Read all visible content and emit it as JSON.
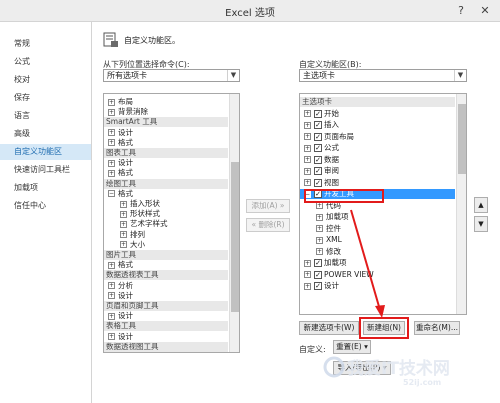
{
  "window": {
    "title": "Excel 选项"
  },
  "sidebar": {
    "items": [
      {
        "label": "常规"
      },
      {
        "label": "公式"
      },
      {
        "label": "校对"
      },
      {
        "label": "保存"
      },
      {
        "label": "语言"
      },
      {
        "label": "高级"
      },
      {
        "label": "自定义功能区"
      },
      {
        "label": "快速访问工具栏"
      },
      {
        "label": "加载项"
      },
      {
        "label": "信任中心"
      }
    ],
    "active_index": 6
  },
  "header": {
    "text": "自定义功能区。"
  },
  "left_panel": {
    "label": "从下列位置选择命令(C):",
    "dropdown_value": "所有选项卡",
    "rows": [
      {
        "text": "布局",
        "kind": "item",
        "indent": 0
      },
      {
        "text": "背景消除",
        "kind": "item",
        "indent": 0
      },
      {
        "text": "SmartArt 工具",
        "kind": "group",
        "indent": 0
      },
      {
        "text": "设计",
        "kind": "item",
        "indent": 0
      },
      {
        "text": "格式",
        "kind": "item",
        "indent": 0
      },
      {
        "text": "图表工具",
        "kind": "group",
        "indent": 0
      },
      {
        "text": "设计",
        "kind": "item",
        "indent": 0
      },
      {
        "text": "格式",
        "kind": "item",
        "indent": 0
      },
      {
        "text": "绘图工具",
        "kind": "group",
        "indent": 0
      },
      {
        "text": "格式",
        "kind": "open",
        "indent": 0
      },
      {
        "text": "插入形状",
        "kind": "item",
        "indent": 1
      },
      {
        "text": "形状样式",
        "kind": "item",
        "indent": 1
      },
      {
        "text": "艺术字样式",
        "kind": "item",
        "indent": 1
      },
      {
        "text": "排列",
        "kind": "item",
        "indent": 1
      },
      {
        "text": "大小",
        "kind": "item",
        "indent": 1
      },
      {
        "text": "图片工具",
        "kind": "group",
        "indent": 0
      },
      {
        "text": "格式",
        "kind": "item",
        "indent": 0
      },
      {
        "text": "数据透视表工具",
        "kind": "group",
        "indent": 0
      },
      {
        "text": "分析",
        "kind": "item",
        "indent": 0
      },
      {
        "text": "设计",
        "kind": "item",
        "indent": 0
      },
      {
        "text": "页眉和页脚工具",
        "kind": "group",
        "indent": 0
      },
      {
        "text": "设计",
        "kind": "item",
        "indent": 0
      },
      {
        "text": "表格工具",
        "kind": "group",
        "indent": 0
      },
      {
        "text": "设计",
        "kind": "item",
        "indent": 0
      },
      {
        "text": "数据透视图工具",
        "kind": "group",
        "indent": 0
      }
    ]
  },
  "middle": {
    "add_label": "添加(A) »",
    "remove_label": "« 删除(R)"
  },
  "right_panel": {
    "label": "自定义功能区(B):",
    "dropdown_value": "主选项卡",
    "rows": [
      {
        "text": "主选项卡",
        "kind": "group",
        "indent": 0
      },
      {
        "text": "开始",
        "kind": "check",
        "indent": 0
      },
      {
        "text": "插入",
        "kind": "check",
        "indent": 0
      },
      {
        "text": "页面布局",
        "kind": "check",
        "indent": 0
      },
      {
        "text": "公式",
        "kind": "check",
        "indent": 0
      },
      {
        "text": "数据",
        "kind": "check",
        "indent": 0
      },
      {
        "text": "审阅",
        "kind": "check",
        "indent": 0
      },
      {
        "text": "视图",
        "kind": "check",
        "indent": 0
      },
      {
        "text": "开发工具",
        "kind": "selected",
        "indent": 0
      },
      {
        "text": "代码",
        "kind": "item",
        "indent": 1
      },
      {
        "text": "加载项",
        "kind": "item",
        "indent": 1
      },
      {
        "text": "控件",
        "kind": "item",
        "indent": 1
      },
      {
        "text": "XML",
        "kind": "item",
        "indent": 1
      },
      {
        "text": "修改",
        "kind": "item",
        "indent": 1
      },
      {
        "text": "加载项",
        "kind": "check",
        "indent": 0
      },
      {
        "text": "POWER VIEW",
        "kind": "check",
        "indent": 0
      },
      {
        "text": "设计",
        "kind": "check",
        "indent": 0
      }
    ],
    "up_symbol": "▲",
    "down_symbol": "▼"
  },
  "buttons": {
    "new_tab": "新建选项卡(W)",
    "new_group": "新建组(N)",
    "rename": "重命名(M)...",
    "custom_label": "自定义:",
    "reset": "重置(E) ▾",
    "import_export": "导入/导出(P) ▾"
  },
  "watermark": {
    "main": "我爱IT技术网",
    "sub": "52ij.com"
  },
  "colors": {
    "selection": "#3399ff",
    "annotation": "#e21b1b",
    "active_nav": "#d5e8f7"
  }
}
